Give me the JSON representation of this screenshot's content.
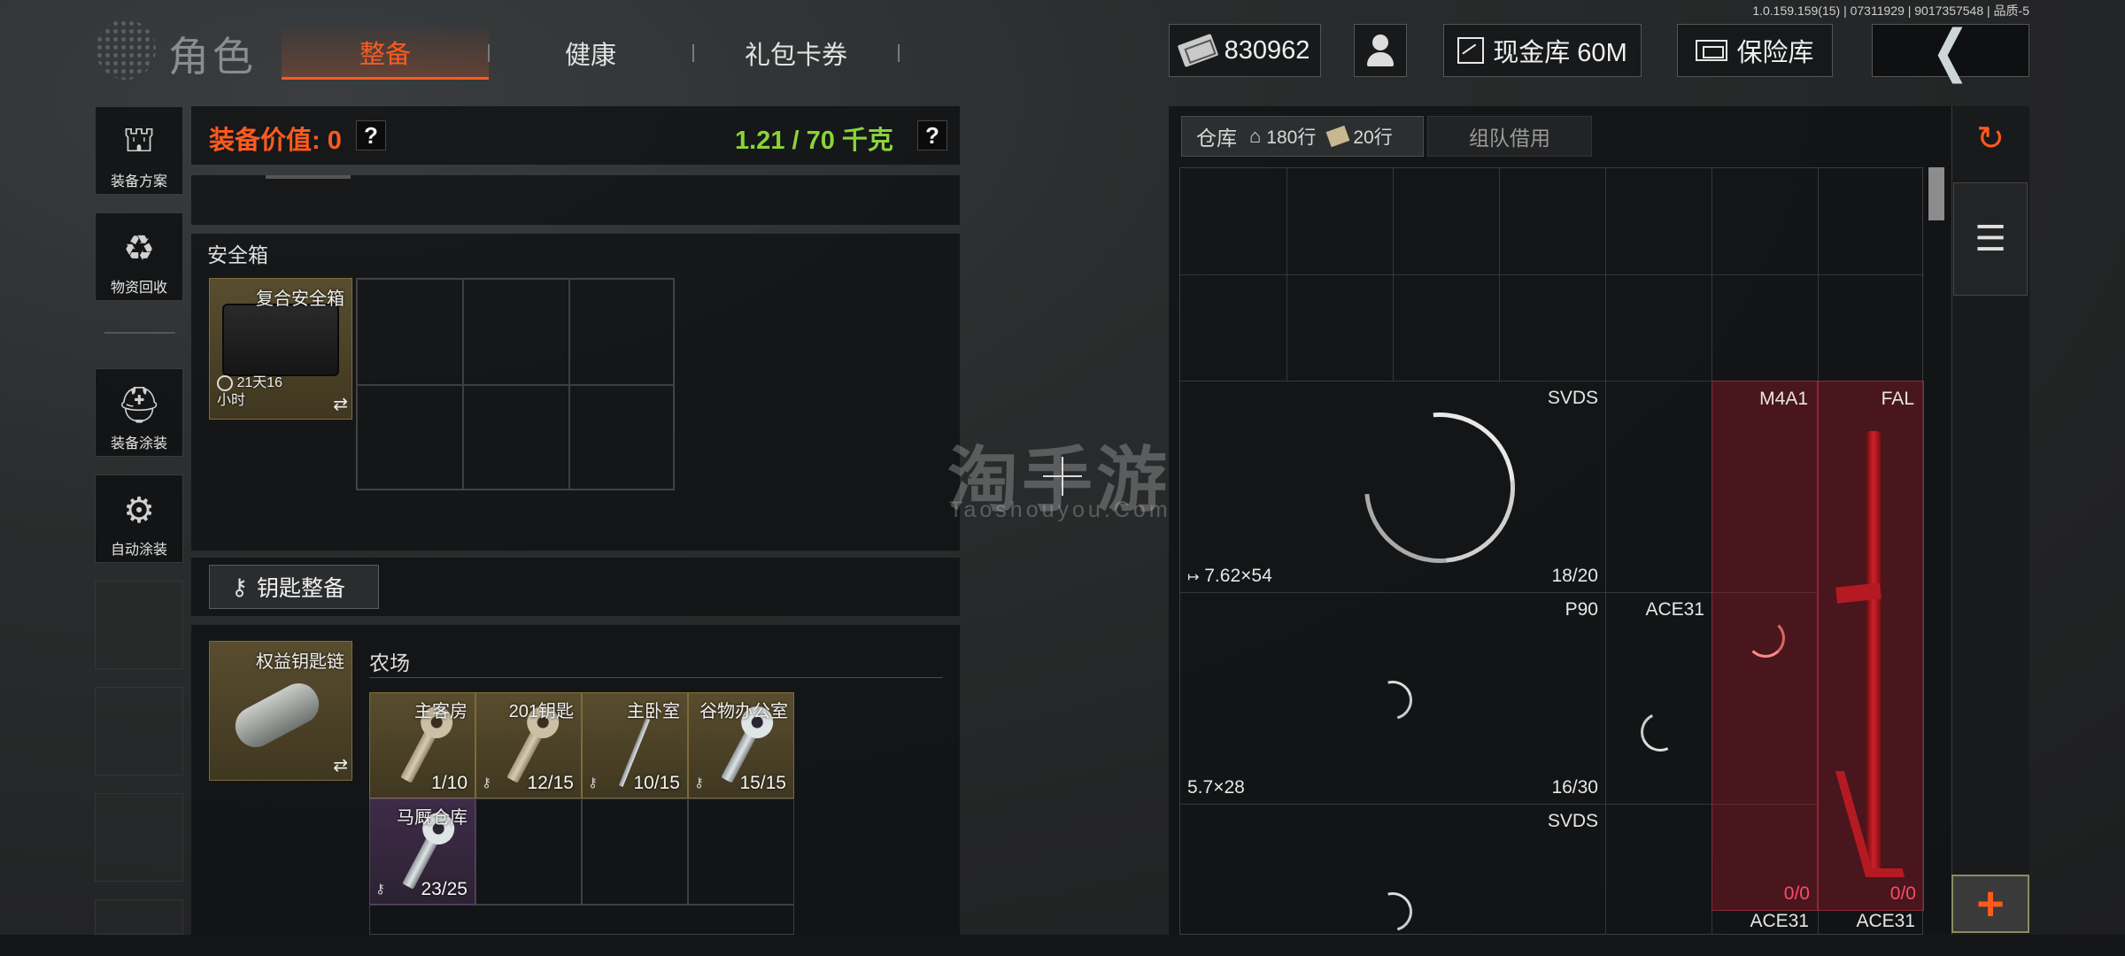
{
  "version_text": "1.0.159.159(15) | 07311929 | 9017357548 | 品质-5",
  "header": {
    "title": "角色",
    "tabs": [
      {
        "label": "整备",
        "active": true
      },
      {
        "label": "健康",
        "active": false
      },
      {
        "label": "礼包卡券",
        "active": false
      }
    ],
    "currency": "830962",
    "cash_vault": "现金库 60M",
    "safe_vault": "保险库"
  },
  "sidebar": {
    "items": [
      {
        "label": "装备方案",
        "icon": "helmet-grid-icon"
      },
      {
        "label": "物资回收",
        "icon": "recycle-icon"
      },
      {
        "label": "装备涂装",
        "icon": "helmet-paint-icon"
      },
      {
        "label": "自动涂装",
        "icon": "brush-gear-icon"
      }
    ]
  },
  "loadout": {
    "value_label": "装备价值: 0",
    "weight_label": "1.21 / 70 千克",
    "help_glyph": "?",
    "safe_box": {
      "section_label": "安全箱",
      "item_name": "复合安全箱",
      "item_timer": "21天16小时"
    },
    "keys": {
      "button_label": "钥匙整备",
      "chain_name": "权益钥匙链",
      "area_label": "农场",
      "items": [
        {
          "name": "主客房",
          "count": "1/10"
        },
        {
          "name": "201钥匙",
          "count": "12/15"
        },
        {
          "name": "主卧室",
          "count": "10/15"
        },
        {
          "name": "谷物办公室",
          "count": "15/15"
        },
        {
          "name": "马厩仓库",
          "count": "23/25"
        }
      ]
    }
  },
  "warehouse": {
    "tab_label": "仓库",
    "home_rows": "180行",
    "ticket_rows": "20行",
    "team_tab": "组队借用",
    "items": [
      {
        "weapon": "SVDS",
        "ammo": "7.62×54",
        "count": "18/20"
      },
      {
        "weapon": "P90",
        "ammo": "5.7×28",
        "count": "16/30"
      },
      {
        "weapon": "ACE31",
        "ammo": "",
        "count": ""
      },
      {
        "weapon": "SVDS",
        "ammo": "",
        "count": ""
      },
      {
        "weapon": "M4A1",
        "ammo": "",
        "count": "0/0"
      },
      {
        "weapon": "FAL",
        "ammo": "",
        "count": "0/0"
      },
      {
        "weapon": "ACE31",
        "ammo": "",
        "count": ""
      },
      {
        "weapon": "ACE31",
        "ammo": "",
        "count": ""
      }
    ]
  },
  "watermark": {
    "main": "淘手游",
    "sub": "Taoshouyou.Com"
  },
  "colors": {
    "accent": "#ff5a1e",
    "weight": "#8ad43b",
    "danger": "#ff4a66"
  }
}
